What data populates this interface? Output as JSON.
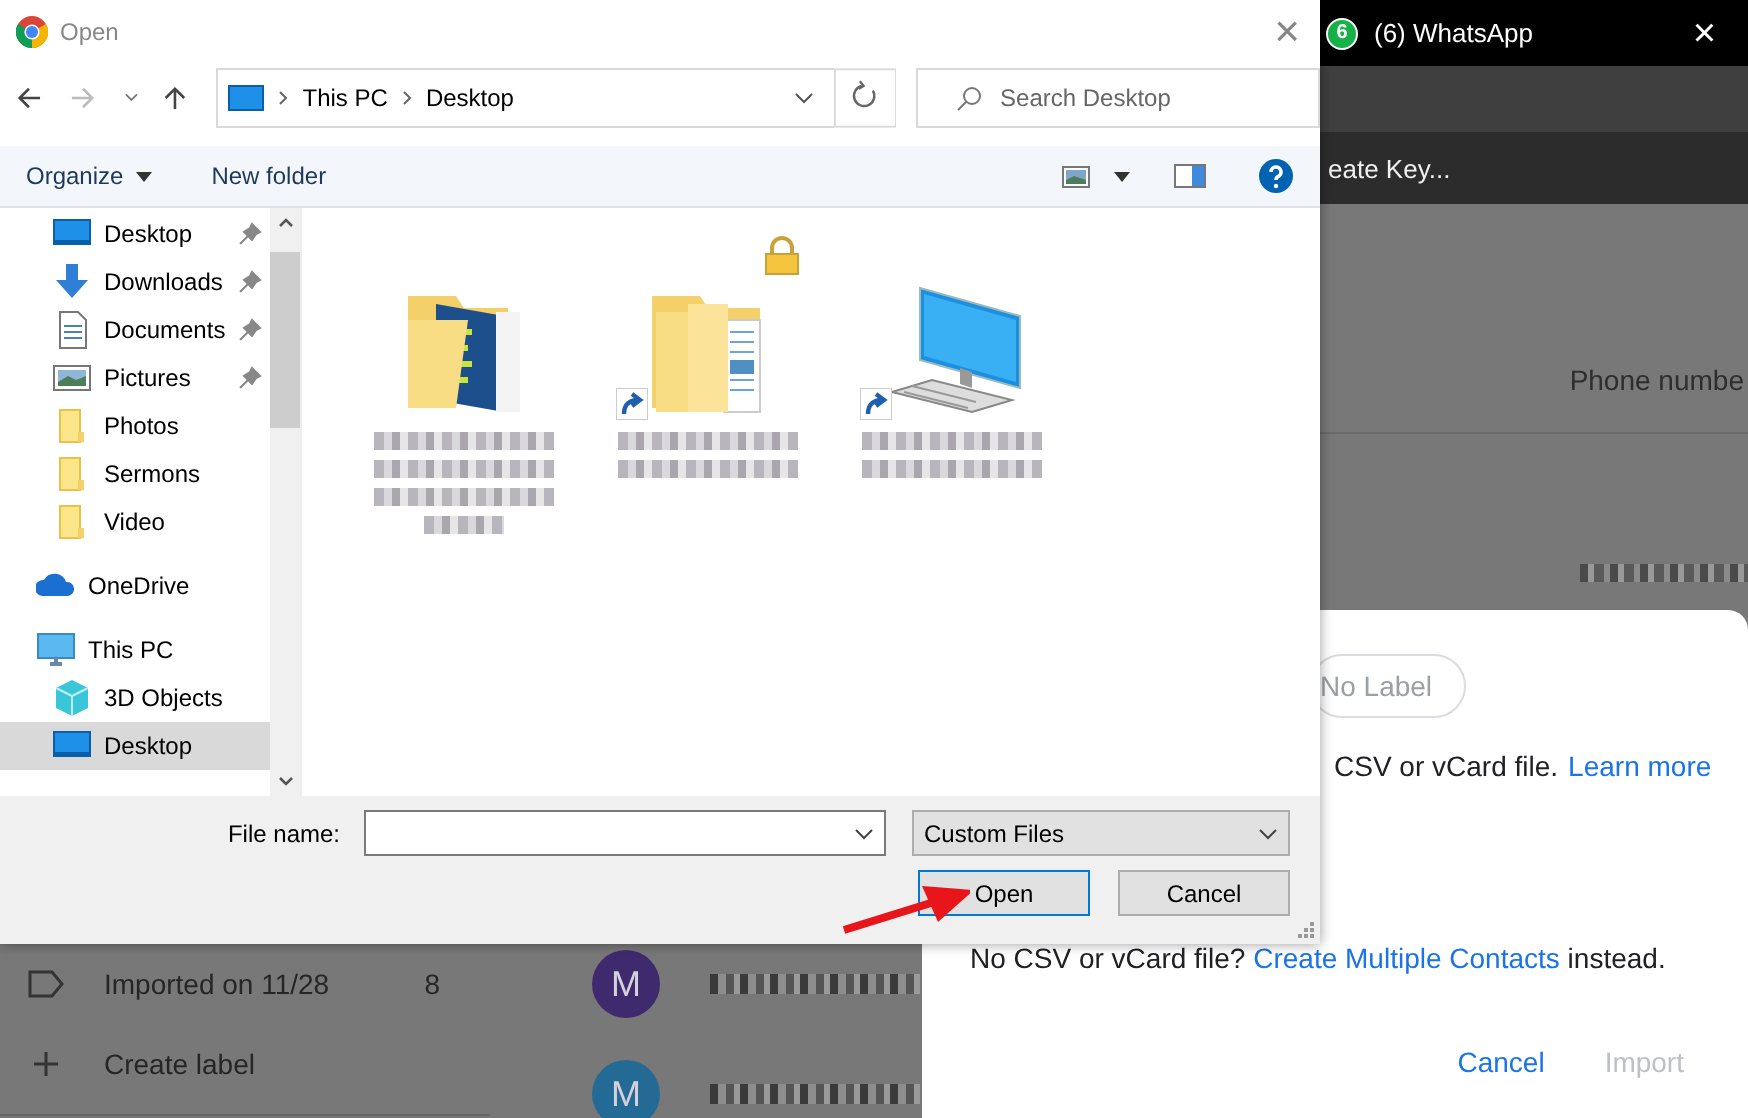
{
  "background_app": {
    "browser_tab": {
      "badge": "6",
      "title": "(6) WhatsApp",
      "close": "×"
    },
    "menu_text": "eate Key...",
    "column_header": "Phone numbe",
    "labels": [
      {
        "kind": "label",
        "name": "Imported on 11/28",
        "count": "8"
      },
      {
        "kind": "create",
        "name": "Create label"
      }
    ],
    "contacts": [
      {
        "initial": "M",
        "color": "#3f2a6e"
      },
      {
        "initial": "M",
        "color": "#236b95"
      }
    ]
  },
  "import_dialog": {
    "chip": "No Label",
    "text": "CSV or vCard file.",
    "link": "Learn more",
    "footer": {
      "before": "No CSV or vCard file?",
      "link": "Create Multiple Contacts",
      "after": "instead."
    },
    "actions": [
      {
        "label": "Cancel",
        "disabled": false
      },
      {
        "label": "Import",
        "disabled": true
      }
    ]
  },
  "open_dialog": {
    "title": "Open",
    "close": "×",
    "nav": {
      "breadcrumb": [
        "This PC",
        "Desktop"
      ],
      "search_placeholder": "Search Desktop"
    },
    "toolbar": {
      "organize": "Organize",
      "new_folder": "New folder"
    },
    "quick_access": [
      {
        "kind": "desktop",
        "label": "Desktop",
        "pinned": true,
        "selected": false
      },
      {
        "kind": "downloads",
        "label": "Downloads",
        "pinned": true,
        "selected": false
      },
      {
        "kind": "documents",
        "label": "Documents",
        "pinned": true,
        "selected": false
      },
      {
        "kind": "pictures",
        "label": "Pictures",
        "pinned": true,
        "selected": false
      },
      {
        "kind": "folder",
        "label": "Photos",
        "pinned": false,
        "selected": false
      },
      {
        "kind": "folder",
        "label": "Sermons",
        "pinned": false,
        "selected": false
      },
      {
        "kind": "folder",
        "label": "Video",
        "pinned": false,
        "selected": false
      }
    ],
    "tree": [
      {
        "kind": "onedrive",
        "label": "OneDrive",
        "selected": false
      },
      {
        "kind": "pc",
        "label": "This PC",
        "selected": false,
        "children": [
          {
            "kind": "objects3d",
            "label": "3D Objects",
            "selected": false
          },
          {
            "kind": "desktop",
            "label": "Desktop",
            "selected": true
          }
        ]
      }
    ],
    "files": [
      {
        "kind": "doc-folder",
        "shortcut": false,
        "locked": false
      },
      {
        "kind": "folder",
        "shortcut": true,
        "locked": true
      },
      {
        "kind": "computer",
        "shortcut": true,
        "locked": false
      }
    ],
    "footer": {
      "file_name_label": "File name:",
      "filter": "Custom Files",
      "buttons": [
        {
          "label": "Open",
          "default": true
        },
        {
          "label": "Cancel",
          "default": false
        }
      ]
    }
  }
}
